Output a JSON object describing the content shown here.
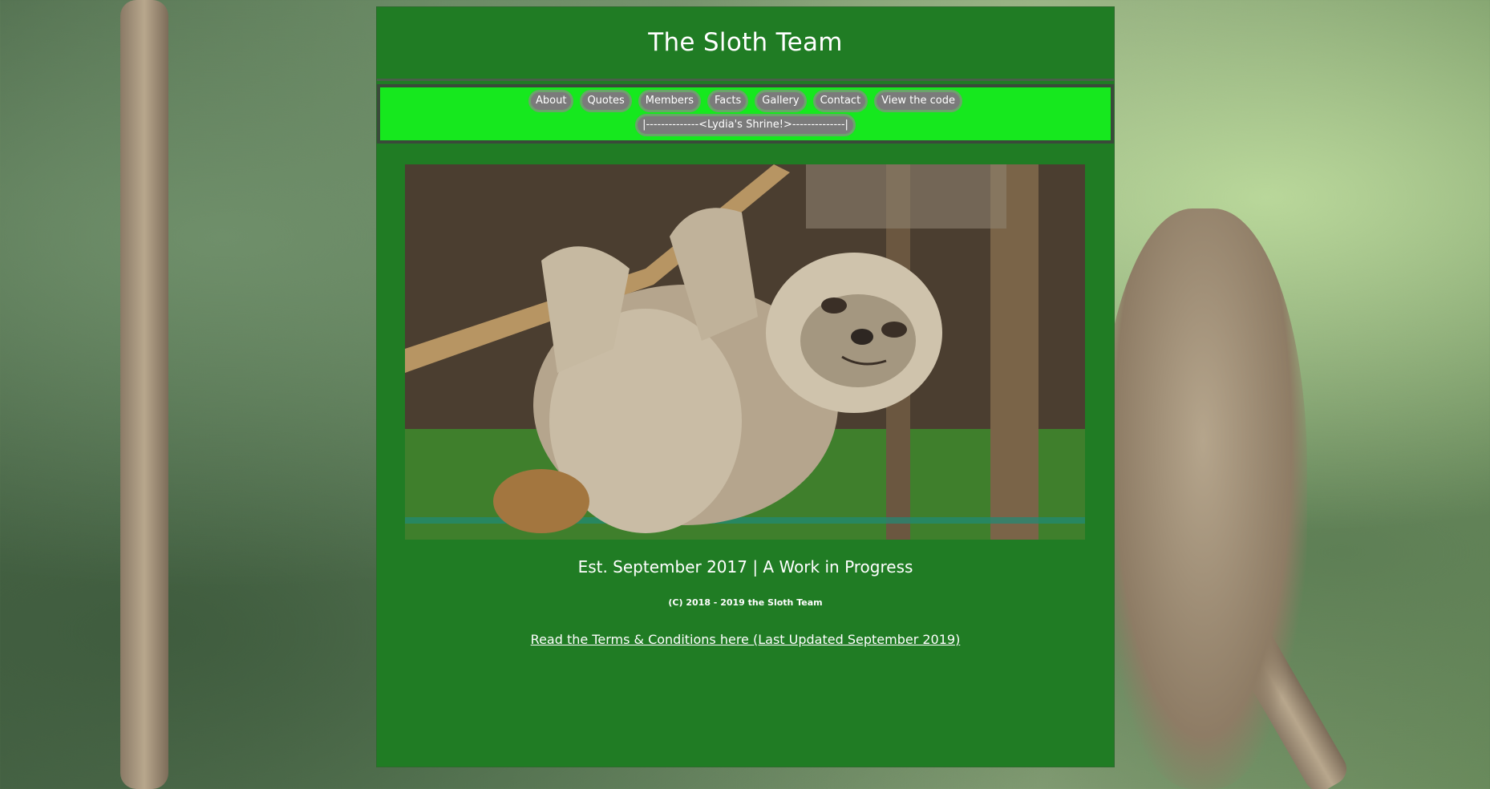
{
  "site": {
    "title": "The Sloth Team"
  },
  "nav": {
    "items": [
      "About",
      "Quotes",
      "Members",
      "Facts",
      "Gallery",
      "Contact",
      "View the code"
    ],
    "shrine_label": "|--------------<Lydia's Shrine!>--------------|"
  },
  "hero": {
    "image_name": "sloth-hanging-on-branch"
  },
  "footer": {
    "established": "Est. September 2017 | A Work in Progress",
    "copyright": "(C) 2018 - 2019 the Sloth Team",
    "terms_link": "Read the Terms & Conditions here (Last Updated September 2019)"
  },
  "colors": {
    "page_bg": "#207c24",
    "nav_bg": "#16e81e",
    "nav_button_bg": "#7b7b7b",
    "text": "#ffffff"
  }
}
